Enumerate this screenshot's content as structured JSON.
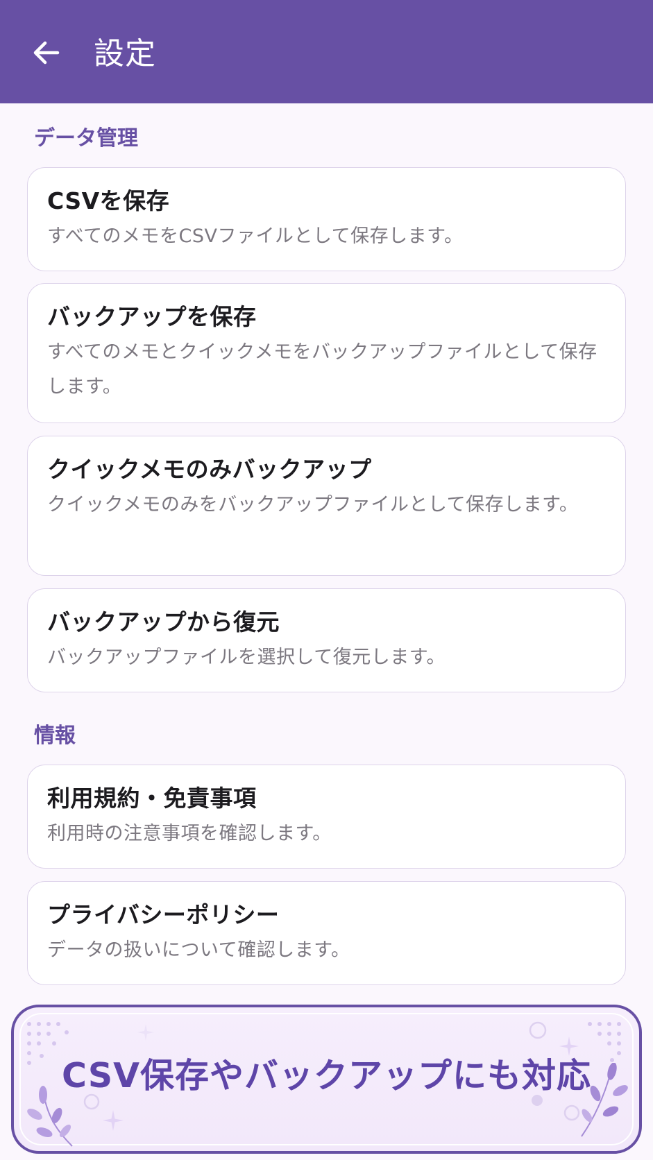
{
  "app_bar": {
    "title": "設定",
    "back_icon": "arrow-left-icon"
  },
  "sections": [
    {
      "header": "データ管理",
      "items": [
        {
          "title": "CSVを保存",
          "description": "すべてのメモをCSVファイルとして保存します。"
        },
        {
          "title": "バックアップを保存",
          "description": "すべてのメモとクイックメモをバックアップファイルとして保存します。"
        },
        {
          "title": "クイックメモのみバックアップ",
          "description": "クイックメモのみをバックアップファイルとして保存します。"
        },
        {
          "title": "バックアップから復元",
          "description": "バックアップファイルを選択して復元します。"
        }
      ]
    },
    {
      "header": "情報",
      "items": [
        {
          "title": "利用規約・免責事項",
          "description": "利用時の注意事項を確認します。"
        },
        {
          "title": "プライバシーポリシー",
          "description": "データの扱いについて確認します。"
        }
      ]
    }
  ],
  "banner": {
    "text": "CSV保存やバックアップにも対応"
  },
  "colors": {
    "primary": "#6750a4",
    "background": "#fbf7fd",
    "card_border": "#ddd3ea",
    "title_text": "#1c1b1f",
    "description_text": "#7c7880",
    "banner_text": "#5e45a8"
  }
}
